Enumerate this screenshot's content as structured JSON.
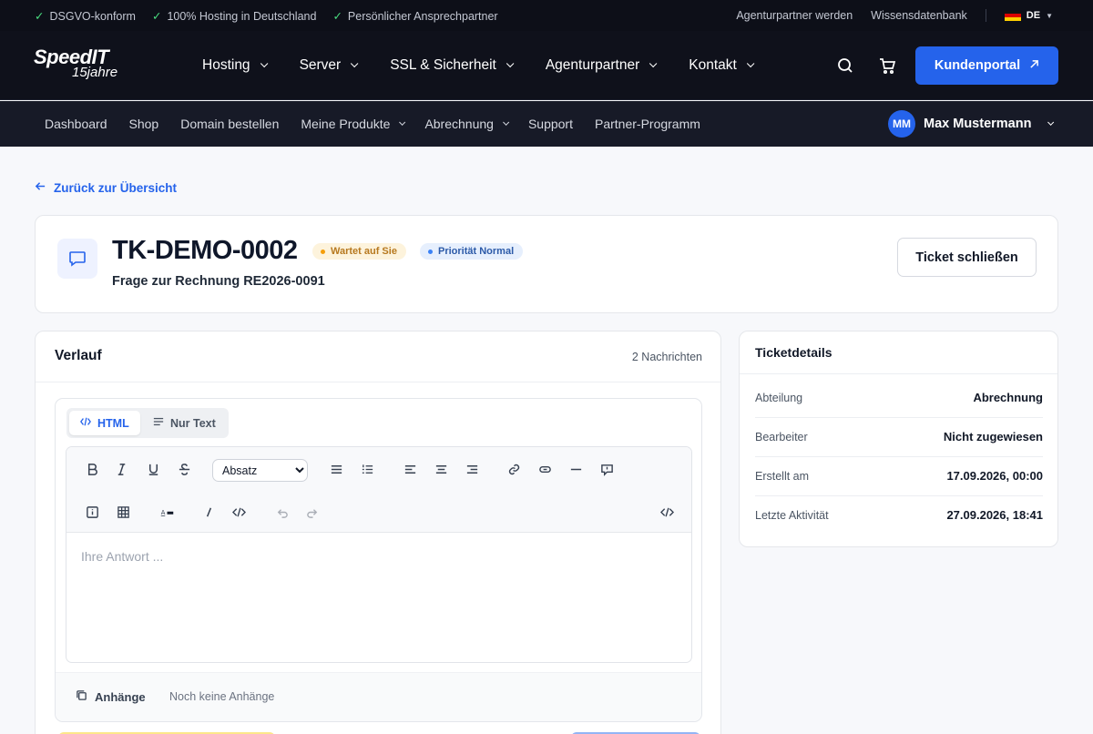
{
  "topbar": {
    "badges": [
      "DSGVO-konform",
      "100% Hosting in Deutschland",
      "Persönlicher Ansprechpartner"
    ],
    "links": [
      "Agenturpartner werden",
      "Wissensdatenbank"
    ],
    "lang": "DE"
  },
  "logo": {
    "line1": "SpeedIT",
    "line2": "15jahre"
  },
  "nav": {
    "items": [
      "Hosting",
      "Server",
      "SSL & Sicherheit",
      "Agenturpartner",
      "Kontakt"
    ],
    "portal_label": "Kundenportal"
  },
  "subnav": {
    "items": [
      "Dashboard",
      "Shop",
      "Domain bestellen",
      "Meine Produkte",
      "Abrechnung",
      "Support",
      "Partner-Programm"
    ],
    "user_initials": "MM",
    "user_name": "Max Mustermann"
  },
  "back_label": "Zurück zur Übersicht",
  "ticket": {
    "id": "TK-DEMO-0002",
    "status": "Wartet auf Sie",
    "priority": "Priorität Normal",
    "subject": "Frage zur Rechnung RE2026-0091",
    "close_label": "Ticket schließen"
  },
  "verlauf": {
    "title": "Verlauf",
    "count": "2 Nachrichten",
    "mode_html": "HTML",
    "mode_text": "Nur Text",
    "format_selected": "Absatz",
    "placeholder": "Ihre Antwort ...",
    "attach_label": "Anhänge",
    "attach_empty": "Noch keine Anhänge"
  },
  "details": {
    "title": "Ticketdetails",
    "rows": [
      {
        "label": "Abteilung",
        "value": "Abrechnung"
      },
      {
        "label": "Bearbeiter",
        "value": "Nicht zugewiesen"
      },
      {
        "label": "Erstellt am",
        "value": "17.09.2026, 00:00"
      },
      {
        "label": "Letzte Aktivität",
        "value": "27.09.2026, 18:41"
      }
    ]
  },
  "colors": {
    "accent": "#2563eb",
    "topbar": "#0d0f18",
    "nav": "#0f111b",
    "subnav": "#171a27",
    "status": "#f59e0b"
  }
}
